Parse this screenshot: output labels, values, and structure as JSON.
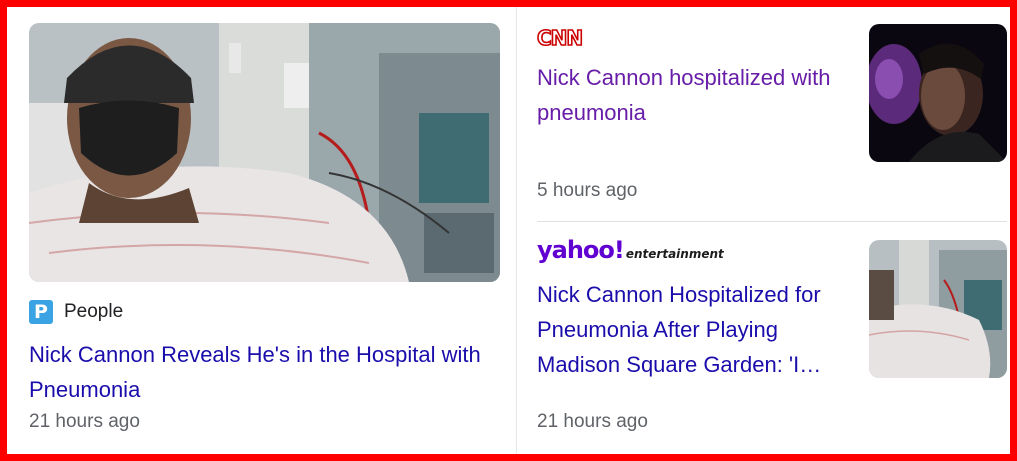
{
  "articles": [
    {
      "source": "People",
      "source_icon": "people-p-icon",
      "headline": "Nick Cannon Reveals He's in the Hospital with Pneumonia",
      "time": "21 hours ago"
    },
    {
      "source": "CNN",
      "source_icon": "cnn-logo",
      "headline": "Nick Cannon hospitalized with pneumonia",
      "time": "5 hours ago"
    },
    {
      "source": "yahoo!",
      "source_sub": "entertainment",
      "source_icon": "yahoo-entertainment-logo",
      "headline": "Nick Cannon Hospitalized for Pneumonia After Playing Madison Square Garden: 'I…",
      "time": "21 hours ago"
    }
  ],
  "colors": {
    "link": "#1a0dab",
    "visited_link": "#681da8",
    "meta_text": "#5f6368",
    "frame": "#ff0000",
    "cnn_red": "#cc0000",
    "yahoo_purple": "#6001d2",
    "people_blue": "#3aa3e3"
  }
}
